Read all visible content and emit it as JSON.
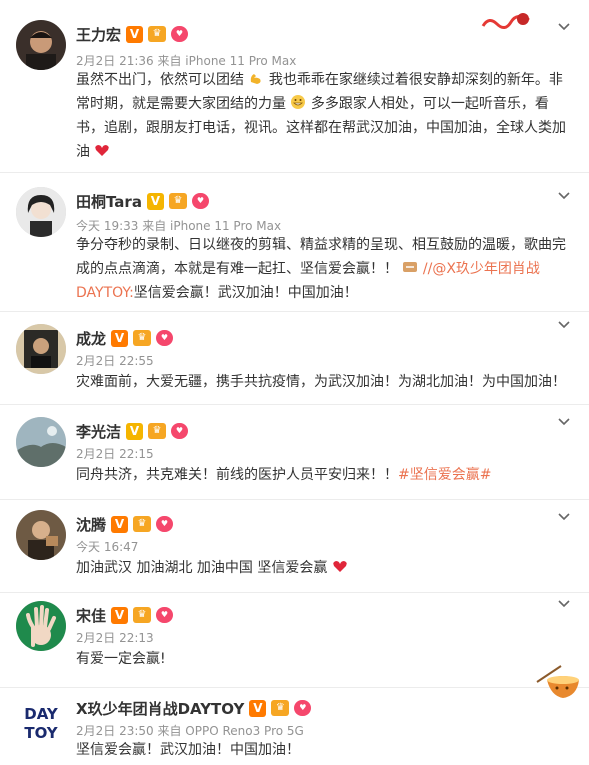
{
  "posts": [
    {
      "name": "王力宏",
      "badge_v": "V",
      "meta": "2月2日 21:36 来自 iPhone 11 Pro Max",
      "text_lines": [
        "虽然不出门，依然可以团结",
        "我也乖乖在家继续过着很安静却深刻的新年。非",
        "常时期，就是需要大家团结的力量",
        "多多跟家人相处，可以一起听音乐，看",
        "书，追剧，跟朋友打电话，视讯。这样都在帮武汉加油，中国加油，全球人类加",
        "油"
      ]
    },
    {
      "name": "田桐Tara",
      "badge_v": "V",
      "meta": "今天 19:33 来自 iPhone 11 Pro Max",
      "text_lines": [
        "争分夺秒的录制、日以继夜的剪辑、精益求精的呈现、相互鼓励的温暖，歌曲完",
        "成的点点滴滴，本就是有难一起扛、坚信爱会赢！！",
        "//@X玖少年团肖战",
        "DAYTOY:",
        "坚信爱会赢！武汉加油！中国加油！"
      ]
    },
    {
      "name": "成龙",
      "badge_v": "V",
      "meta": "2月2日 22:55",
      "text_lines": [
        "灾难面前，大爱无疆，携手共抗疫情，为武汉加油！为湖北加油！为中国加油！"
      ]
    },
    {
      "name": "李光洁",
      "badge_v": "V",
      "meta": "2月2日 22:15",
      "text_lines": [
        "同舟共济，共克难关！前线的医护人员平安归来！！",
        "#坚信爱会赢#"
      ]
    },
    {
      "name": "沈腾",
      "badge_v": "V",
      "meta": "今天 16:47",
      "text_lines": [
        "加油武汉 加油湖北 加油中国 坚信爱会赢"
      ]
    },
    {
      "name": "宋佳",
      "badge_v": "V",
      "meta": "2月2日 22:13",
      "text_lines": [
        "有爱一定会赢!"
      ]
    },
    {
      "name": "X玖少年团肖战DAYTOY",
      "badge_v": "V",
      "meta": "2月2日 23:50 来自 OPPO Reno3 Pro 5G",
      "text_lines": [
        "坚信爱会赢！武汉加油！中国加油！"
      ]
    }
  ],
  "avatar_logo_text": [
    "DAY",
    "TOY"
  ],
  "badge_crown_label": "crown",
  "badge_heart_label": "heart",
  "colors": {
    "link_orange": "#eb7350",
    "meta_gray": "#939393",
    "badge_orange": "#ff7a00",
    "badge_gold": "#f5b500",
    "heart_red": "#e0263a"
  },
  "icons": [
    "chevron-down-icon",
    "strong-arm-emoji",
    "grin-emoji",
    "heart-emoji",
    "repost-icon"
  ]
}
